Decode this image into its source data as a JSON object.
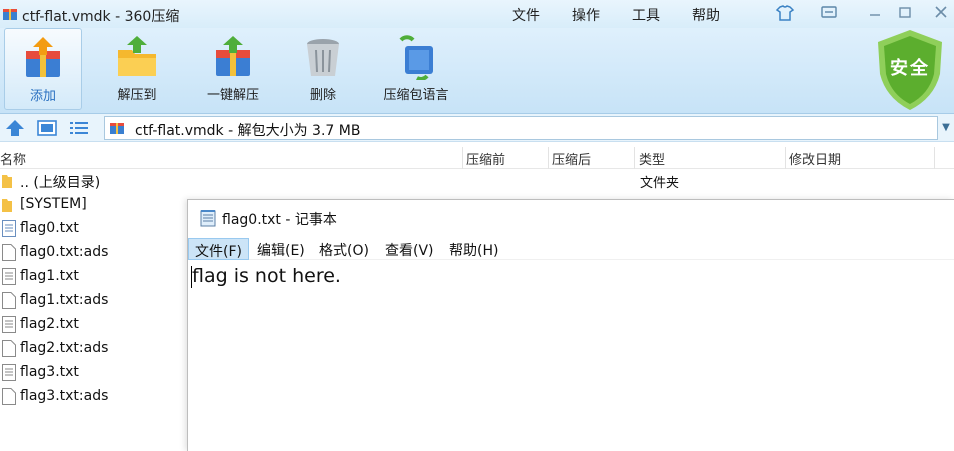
{
  "window": {
    "title": "ctf-flat.vmdk - 360压缩",
    "menus": [
      "文件",
      "操作",
      "工具",
      "帮助"
    ]
  },
  "toolbar": {
    "buttons": [
      {
        "label": "添加",
        "icon": "add-archive-icon"
      },
      {
        "label": "解压到",
        "icon": "extract-to-icon"
      },
      {
        "label": "一键解压",
        "icon": "one-click-extract-icon"
      },
      {
        "label": "删除",
        "icon": "trash-bin-icon"
      },
      {
        "label": "压缩包语言",
        "icon": "archive-language-icon"
      }
    ],
    "security_badge": "安全"
  },
  "address": {
    "text": "ctf-flat.vmdk - 解包大小为 3.7 MB"
  },
  "columns": [
    "名称",
    "压缩前",
    "压缩后",
    "类型",
    "修改日期"
  ],
  "files": [
    {
      "name": ".. (上级目录)",
      "type": "文件夹",
      "kind": "folder"
    },
    {
      "name": "[SYSTEM]",
      "type": "",
      "kind": "folder"
    },
    {
      "name": "flag0.txt",
      "type": "",
      "kind": "text"
    },
    {
      "name": "flag0.txt:ads",
      "type": "",
      "kind": "blank"
    },
    {
      "name": "flag1.txt",
      "type": "",
      "kind": "text"
    },
    {
      "name": "flag1.txt:ads",
      "type": "",
      "kind": "blank"
    },
    {
      "name": "flag2.txt",
      "type": "",
      "kind": "text"
    },
    {
      "name": "flag2.txt:ads",
      "type": "",
      "kind": "blank"
    },
    {
      "name": "flag3.txt",
      "type": "",
      "kind": "text"
    },
    {
      "name": "flag3.txt:ads",
      "type": "",
      "kind": "blank"
    }
  ],
  "notepad": {
    "title": "flag0.txt - 记事本",
    "menus": [
      "文件(F)",
      "编辑(E)",
      "格式(O)",
      "查看(V)",
      "帮助(H)"
    ],
    "content": "flag is not here."
  },
  "colors": {
    "accent_blue": "#2b71c1",
    "toolbar_bg": "#c7e3f7",
    "shield_green": "#5cae2e"
  }
}
